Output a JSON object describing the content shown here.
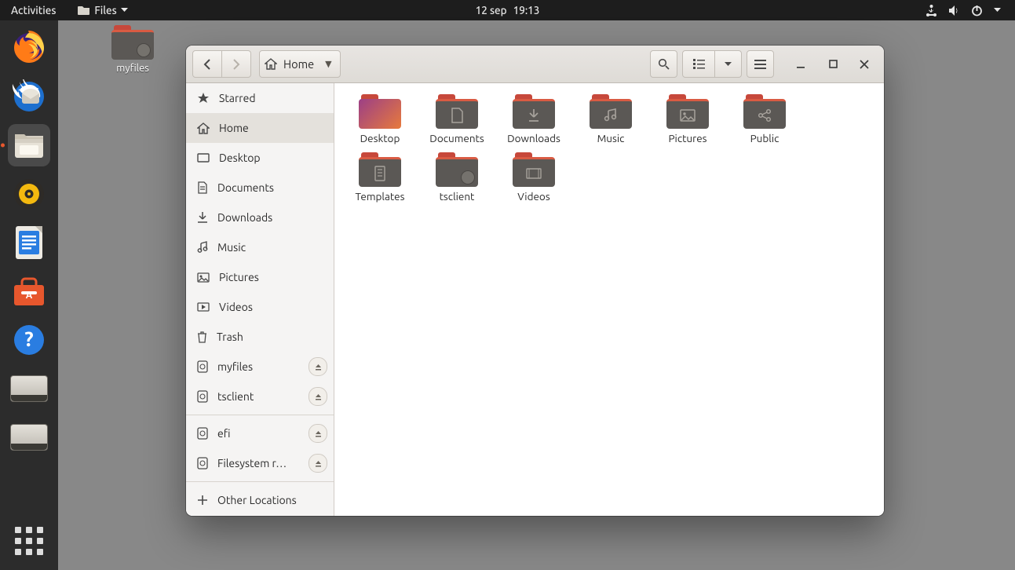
{
  "topbar": {
    "activities": "Activities",
    "app_menu": "Files",
    "date": "12 sep",
    "time": "19:13"
  },
  "dock": {
    "items": [
      {
        "name": "firefox"
      },
      {
        "name": "thunderbird"
      },
      {
        "name": "files",
        "active": true
      },
      {
        "name": "rhythmbox"
      },
      {
        "name": "libreoffice-writer"
      },
      {
        "name": "ubuntu-software"
      },
      {
        "name": "help"
      },
      {
        "name": "disk-a"
      },
      {
        "name": "disk-b"
      }
    ]
  },
  "desktop_icons": [
    {
      "name": "myfiles",
      "label": "myfiles"
    }
  ],
  "window": {
    "path_label": "Home",
    "sidebar": {
      "starred": "Starred",
      "home": "Home",
      "desktop": "Desktop",
      "documents": "Documents",
      "downloads": "Downloads",
      "music": "Music",
      "pictures": "Pictures",
      "videos": "Videos",
      "trash": "Trash",
      "myfiles": "myfiles",
      "tsclient": "tsclient",
      "efi": "efi",
      "fsroot": "Filesystem r…",
      "other": "Other Locations"
    },
    "files": [
      {
        "name": "Desktop",
        "type": "desktop"
      },
      {
        "name": "Documents",
        "glyph": "doc"
      },
      {
        "name": "Downloads",
        "glyph": "dl"
      },
      {
        "name": "Music",
        "glyph": "music"
      },
      {
        "name": "Pictures",
        "glyph": "pic"
      },
      {
        "name": "Public",
        "glyph": "share"
      },
      {
        "name": "Templates",
        "glyph": "tmpl"
      },
      {
        "name": "tsclient",
        "type": "mount"
      },
      {
        "name": "Videos",
        "glyph": "vid"
      }
    ]
  }
}
